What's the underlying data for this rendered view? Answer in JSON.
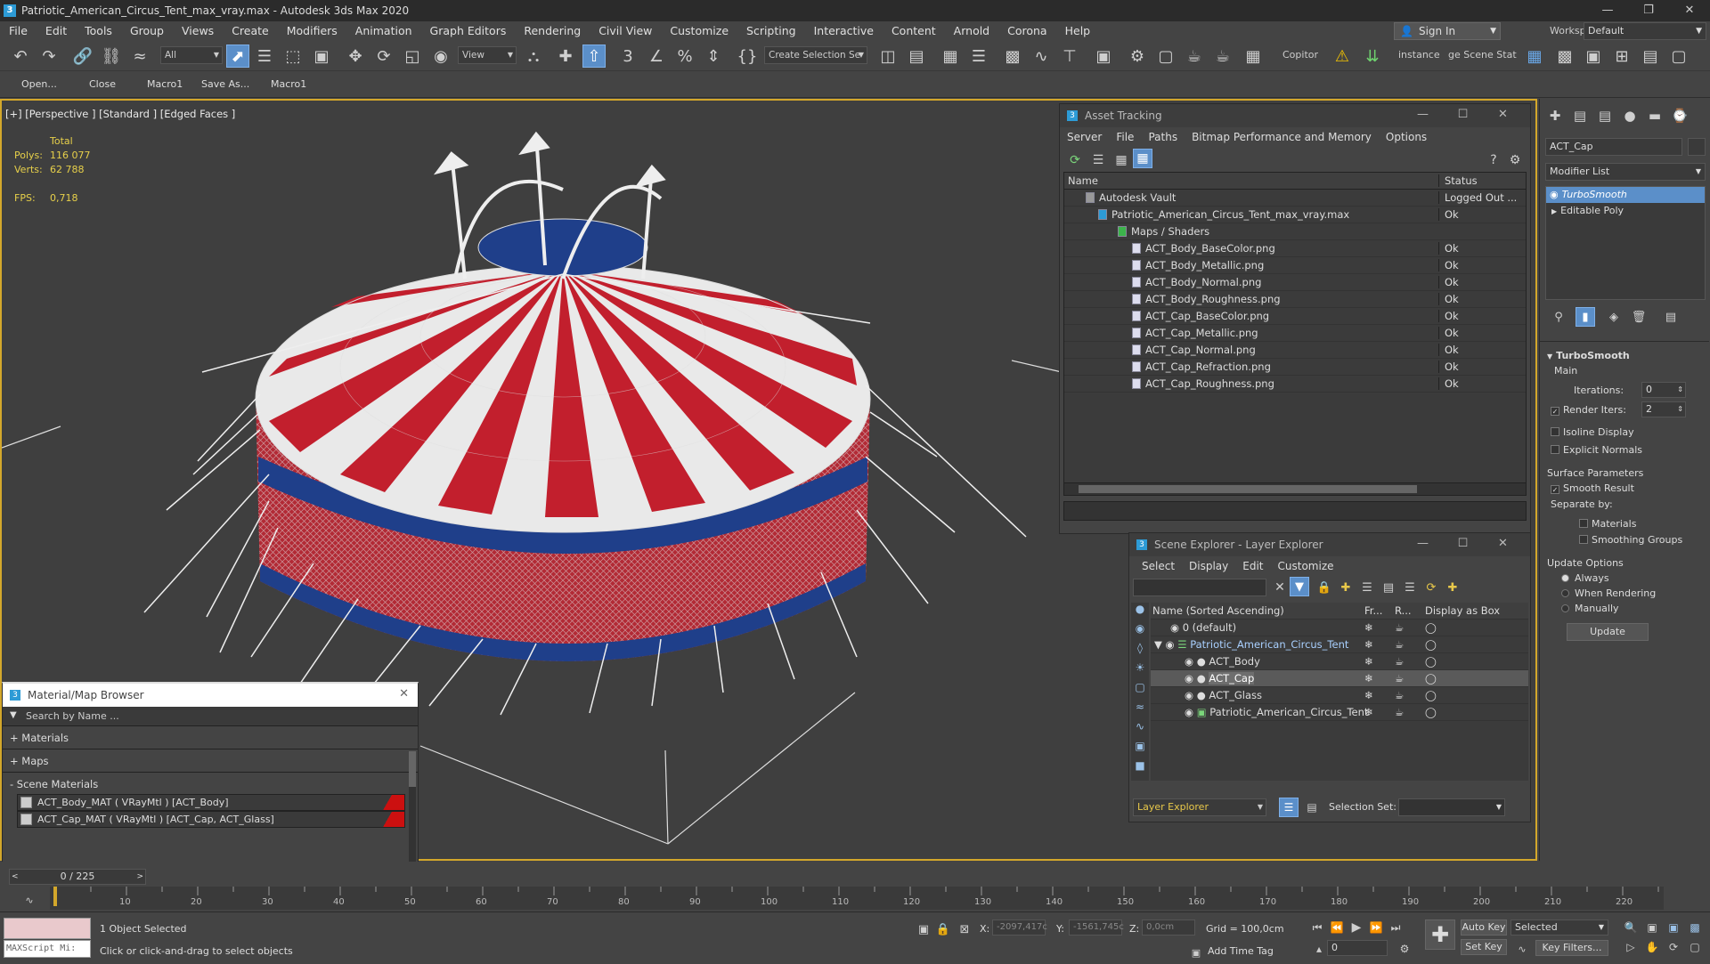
{
  "window": {
    "title": "Patriotic_American_Circus_Tent_max_vray.max - Autodesk 3ds Max 2020",
    "logo": "3"
  },
  "menu": [
    "File",
    "Edit",
    "Tools",
    "Group",
    "Views",
    "Create",
    "Modifiers",
    "Animation",
    "Graph Editors",
    "Rendering",
    "Civil View",
    "Customize",
    "Scripting",
    "Interactive",
    "Content",
    "Arnold",
    "Corona",
    "Help"
  ],
  "account": {
    "signin_label": "Sign In",
    "workspaces_label": "Workspaces:",
    "workspace": "Default"
  },
  "toolbar": {
    "filter_value": "All",
    "refcoord_value": "View",
    "selection_set_value": "Create Selection Se",
    "copitor_label": "Copitor",
    "instance_label": "instance",
    "scene_stat_label": "ge Scene Stat"
  },
  "macros": [
    "Open...",
    "Close",
    "Macro1",
    "Save As...",
    "Macro1"
  ],
  "viewport": {
    "label": "[+] [Perspective ] [Standard ] [Edged Faces ]",
    "stats": {
      "total_label": "Total",
      "polys_label": "Polys:",
      "polys": "116 077",
      "verts_label": "Verts:",
      "verts": "62 788",
      "fps_label": "FPS:",
      "fps": "0,718"
    }
  },
  "asset_tracking": {
    "title": "Asset Tracking",
    "menu": [
      "Server",
      "File",
      "Paths",
      "Bitmap Performance and Memory",
      "Options"
    ],
    "columns": {
      "name": "Name",
      "status": "Status"
    },
    "rows": [
      {
        "name": "Autodesk Vault",
        "status": "Logged Out ..."
      },
      {
        "name": "Patriotic_American_Circus_Tent_max_vray.max",
        "status": "Ok"
      },
      {
        "name": "Maps / Shaders",
        "status": ""
      },
      {
        "name": "ACT_Body_BaseColor.png",
        "status": "Ok"
      },
      {
        "name": "ACT_Body_Metallic.png",
        "status": "Ok"
      },
      {
        "name": "ACT_Body_Normal.png",
        "status": "Ok"
      },
      {
        "name": "ACT_Body_Roughness.png",
        "status": "Ok"
      },
      {
        "name": "ACT_Cap_BaseColor.png",
        "status": "Ok"
      },
      {
        "name": "ACT_Cap_Metallic.png",
        "status": "Ok"
      },
      {
        "name": "ACT_Cap_Normal.png",
        "status": "Ok"
      },
      {
        "name": "ACT_Cap_Refraction.png",
        "status": "Ok"
      },
      {
        "name": "ACT_Cap_Roughness.png",
        "status": "Ok"
      }
    ]
  },
  "scene_explorer": {
    "title": "Scene Explorer - Layer Explorer",
    "menu": [
      "Select",
      "Display",
      "Edit",
      "Customize"
    ],
    "columns": {
      "name": "Name (Sorted Ascending)",
      "frozen": "Fr...",
      "render": "R...",
      "box": "Display as Box"
    },
    "rows": [
      {
        "name": "0 (default)"
      },
      {
        "name": "Patriotic_American_Circus_Tent"
      },
      {
        "name": "ACT_Body"
      },
      {
        "name": "ACT_Cap"
      },
      {
        "name": "ACT_Glass"
      },
      {
        "name": "Patriotic_American_Circus_Tent"
      }
    ],
    "explorer_type": "Layer Explorer",
    "selection_set_label": "Selection Set:"
  },
  "material_browser": {
    "title": "Material/Map Browser",
    "search_placeholder": "Search by Name ...",
    "sections": [
      "+ Materials",
      "+ Maps",
      "- Scene Materials"
    ],
    "materials": [
      "ACT_Body_MAT ( VRayMtl ) [ACT_Body]",
      "ACT_Cap_MAT ( VRayMtl ) [ACT_Cap, ACT_Glass]"
    ]
  },
  "command_panel": {
    "object_name": "ACT_Cap",
    "modifier_list_label": "Modifier List",
    "stack": [
      "TurboSmooth",
      "Editable Poly"
    ],
    "turbosmooth": {
      "title": "TurboSmooth",
      "main_label": "Main",
      "iterations_label": "Iterations:",
      "iterations": "0",
      "render_iters_label": "Render Iters:",
      "render_iters": "2",
      "isoline": "Isoline Display",
      "explicit_normals": "Explicit Normals",
      "surface_params": "Surface Parameters",
      "smooth_result": "Smooth Result",
      "separate_by": "Separate by:",
      "materials": "Materials",
      "smoothing_groups": "Smoothing Groups",
      "update_options": "Update Options",
      "always": "Always",
      "when_rendering": "When Rendering",
      "manually": "Manually",
      "update_button": "Update"
    }
  },
  "timeline": {
    "frame": "0 / 225",
    "ticks": [
      "10",
      "20",
      "30",
      "40",
      "50",
      "60",
      "70",
      "80",
      "90",
      "100",
      "110",
      "120",
      "130",
      "140",
      "150",
      "160",
      "170",
      "180",
      "190",
      "200",
      "210",
      "220"
    ]
  },
  "status": {
    "maxscript": "MAXScript Mi:",
    "selected": "1 Object Selected",
    "hint": "Click or click-and-drag to select objects",
    "x_label": "X:",
    "x": "-2097,417c",
    "y_label": "Y:",
    "y": "-1561,745c",
    "z_label": "Z:",
    "z": "0,0cm",
    "grid": "Grid = 100,0cm",
    "add_time_tag": "Add Time Tag",
    "auto_key": "Auto Key",
    "set_key": "Set Key",
    "key_mode": "Selected",
    "key_filters": "Key Filters...",
    "frame_value": "0"
  }
}
